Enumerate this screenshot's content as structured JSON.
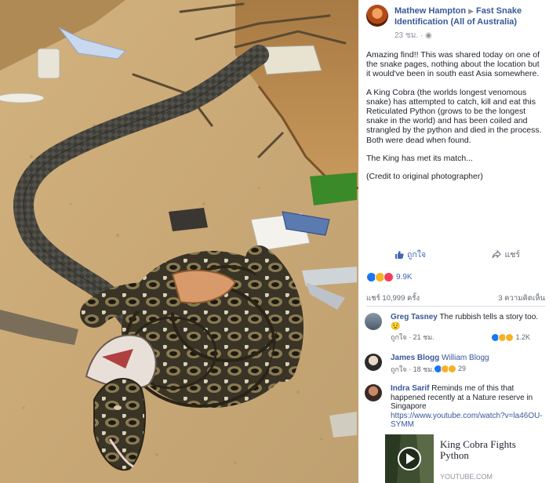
{
  "post": {
    "author": "Mathew Hampton",
    "group": "Fast Snake Identification (All of Australia)",
    "timestamp": "23 ชม.",
    "paragraphs": [
      "Amazing find!! This was shared today on one of the snake pages, nothing about the location but it would've been in south east Asia somewhere.",
      "A King Cobra (the worlds longest venomous snake) has attempted to catch, kill and eat this Reticulated Python (grows to be the longest snake in the world) and has been coiled and strangled by the python and died in the process. Both were dead when found.",
      "The King has met its match...",
      "(Credit to original photographer)"
    ]
  },
  "actions": {
    "like_label": "ถูกใจ",
    "share_label": "แชร์"
  },
  "reactions": {
    "total": "9.9K",
    "shares": "แชร์ 10,999 ครั้ง",
    "comments": "3 ความคิดเห็น"
  },
  "comments": [
    {
      "name": "Greg Tasney",
      "text": "The rubbish tells a story too.",
      "like_label": "ถูกใจ",
      "time": "21 ชม.",
      "count": "1.2K"
    },
    {
      "name": "James Blogg",
      "text": "William Blogg",
      "like_label": "ถูกใจ",
      "time": "18 ชม.",
      "count": "29"
    },
    {
      "name": "Indra Sarif",
      "text": "Reminds me of this that happened recently at a Nature reserve in Singapore",
      "link": "https://www.youtube.com/watch?v=la46OU-SYMM"
    }
  ],
  "link_preview": {
    "title": "King Cobra Fights Python",
    "domain": "YOUTUBE.COM"
  },
  "colors": {
    "link": "#385898",
    "fb_blue": "#4267b2",
    "meta": "#90949c"
  }
}
